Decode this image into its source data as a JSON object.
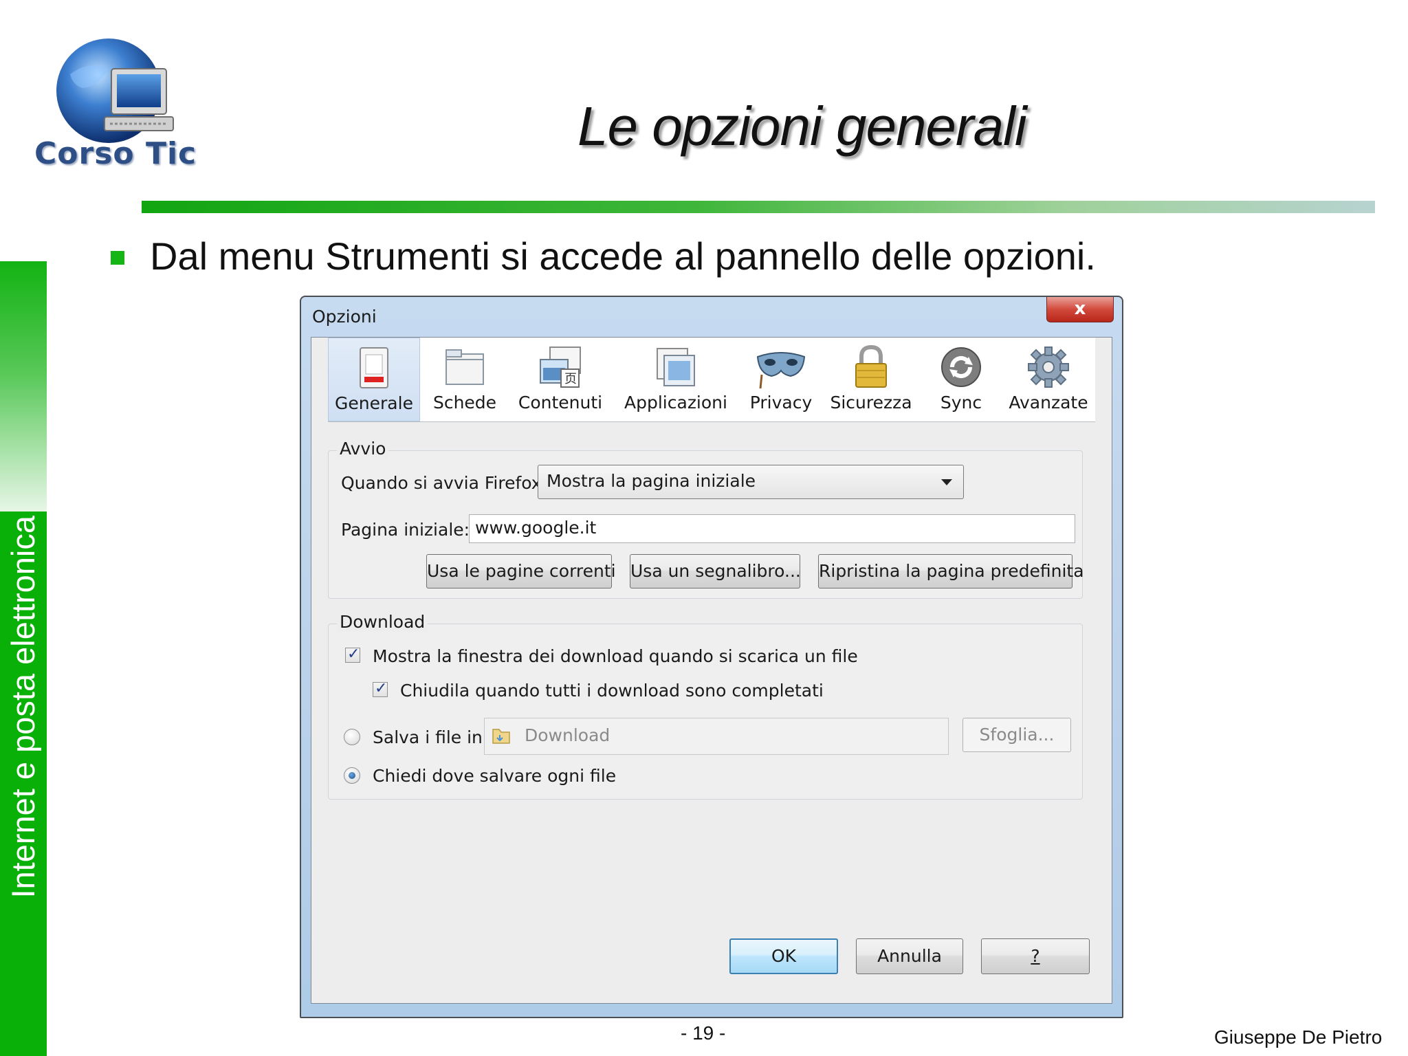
{
  "logo": {
    "text": "Corso Tic"
  },
  "slide": {
    "title": "Le opzioni generali",
    "bullet": "Dal menu Strumenti si accede al pannello delle opzioni.",
    "side_text": "Internet e posta elettronica",
    "page_number": "- 19 -",
    "author": "Giuseppe De Pietro"
  },
  "dialog": {
    "title": "Opzioni",
    "close_label": "x",
    "tabs": [
      {
        "label": "Generale",
        "icon": "switch-icon",
        "selected": true
      },
      {
        "label": "Schede",
        "icon": "tabs-icon",
        "selected": false
      },
      {
        "label": "Contenuti",
        "icon": "content-icon",
        "selected": false
      },
      {
        "label": "Applicazioni",
        "icon": "applications-icon",
        "selected": false
      },
      {
        "label": "Privacy",
        "icon": "mask-icon",
        "selected": false
      },
      {
        "label": "Sicurezza",
        "icon": "padlock-icon",
        "selected": false
      },
      {
        "label": "Sync",
        "icon": "sync-icon",
        "selected": false
      },
      {
        "label": "Avanzate",
        "icon": "gear-icon",
        "selected": false
      }
    ],
    "startup": {
      "group_label": "Avvio",
      "when_starts_label": "Quando si avvia Firefox:",
      "when_starts_value": "Mostra la pagina iniziale",
      "homepage_label": "Pagina iniziale:",
      "homepage_value": "www.google.it",
      "buttons": {
        "use_current": "Usa le pagine correnti",
        "use_bookmark": "Usa un segnalibro...",
        "restore_default": "Ripristina la pagina predefinita"
      }
    },
    "downloads": {
      "group_label": "Download",
      "show_window_label": "Mostra la finestra dei download quando si scarica un file",
      "show_window_checked": true,
      "close_when_done_label": "Chiudila quando tutti i download sono completati",
      "close_when_done_checked": true,
      "save_to_label": "Salva i file in",
      "save_to_selected": false,
      "folder_value": "Download",
      "browse_label": "Sfoglia...",
      "ask_label": "Chiedi dove salvare ogni file",
      "ask_selected": true
    },
    "footer": {
      "ok": "OK",
      "cancel": "Annulla",
      "help": "?"
    }
  }
}
